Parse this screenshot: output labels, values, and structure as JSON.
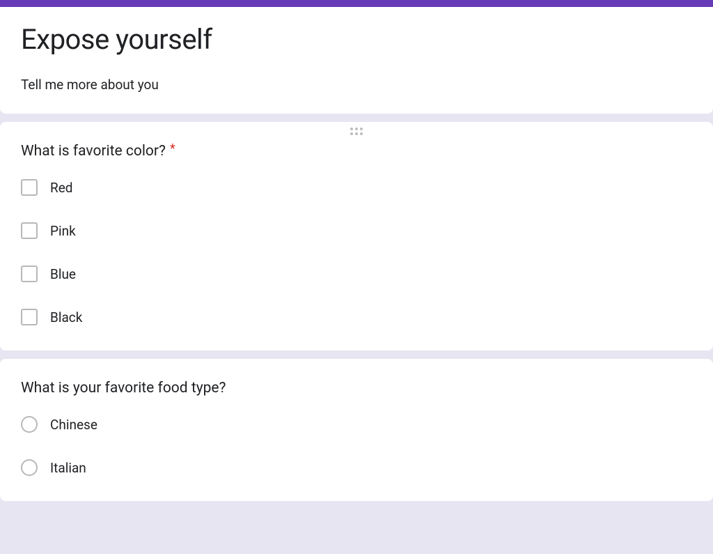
{
  "form": {
    "title": "Expose yourself",
    "description": "Tell me more about you"
  },
  "questions": [
    {
      "title": "What is favorite color?",
      "required": true,
      "type": "checkbox",
      "options": [
        "Red",
        "Pink",
        "Blue",
        "Black"
      ]
    },
    {
      "title": "What is your favorite food type?",
      "required": false,
      "type": "radio",
      "options": [
        "Chinese",
        "Italian"
      ]
    }
  ],
  "colors": {
    "accent": "#673ab7",
    "required": "#d93025"
  }
}
